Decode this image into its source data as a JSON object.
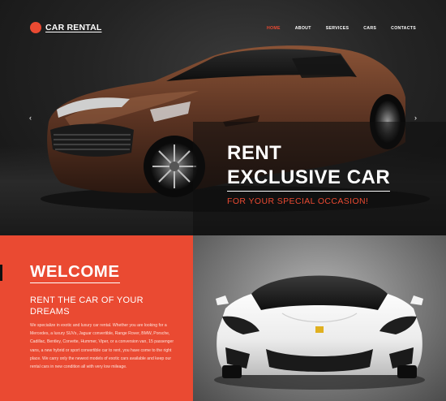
{
  "header": {
    "logo_text": "CAR RENTAL",
    "nav": [
      {
        "label": "HOME",
        "active": true
      },
      {
        "label": "ABOUT",
        "active": false
      },
      {
        "label": "SERVICES",
        "active": false
      },
      {
        "label": "CARS",
        "active": false
      },
      {
        "label": "CONTACTS",
        "active": false
      }
    ]
  },
  "hero": {
    "title_line1": "RENT",
    "title_line2": "EXCLUSIVE CAR",
    "subtitle": "FOR YOUR SPECIAL OCCASION!",
    "prev_arrow": "‹",
    "next_arrow": "›"
  },
  "welcome": {
    "title": "WELCOME",
    "subtitle": "RENT THE CAR OF YOUR DREAMS",
    "body": "We specialize in exotic and luxury car rental. Whether you are looking for a Mercedes, a luxury SUVs, Jaguar convertible, Range Rover, BMW, Porsche, Cadillac, Bentley, Corvette, Hummer, Viper, or a conversion van, 15 passenger vans, a new hybrid or sport convertible car to rent, you have come to the right place. We carry only the newest models of exotic cars available and keep our rental cars in new condition all with very low mileage."
  },
  "colors": {
    "accent": "#ea4a32",
    "dark_bg": "#1b1b1b",
    "hero_car": "#5a3322",
    "white_car": "#f1f1f1"
  }
}
